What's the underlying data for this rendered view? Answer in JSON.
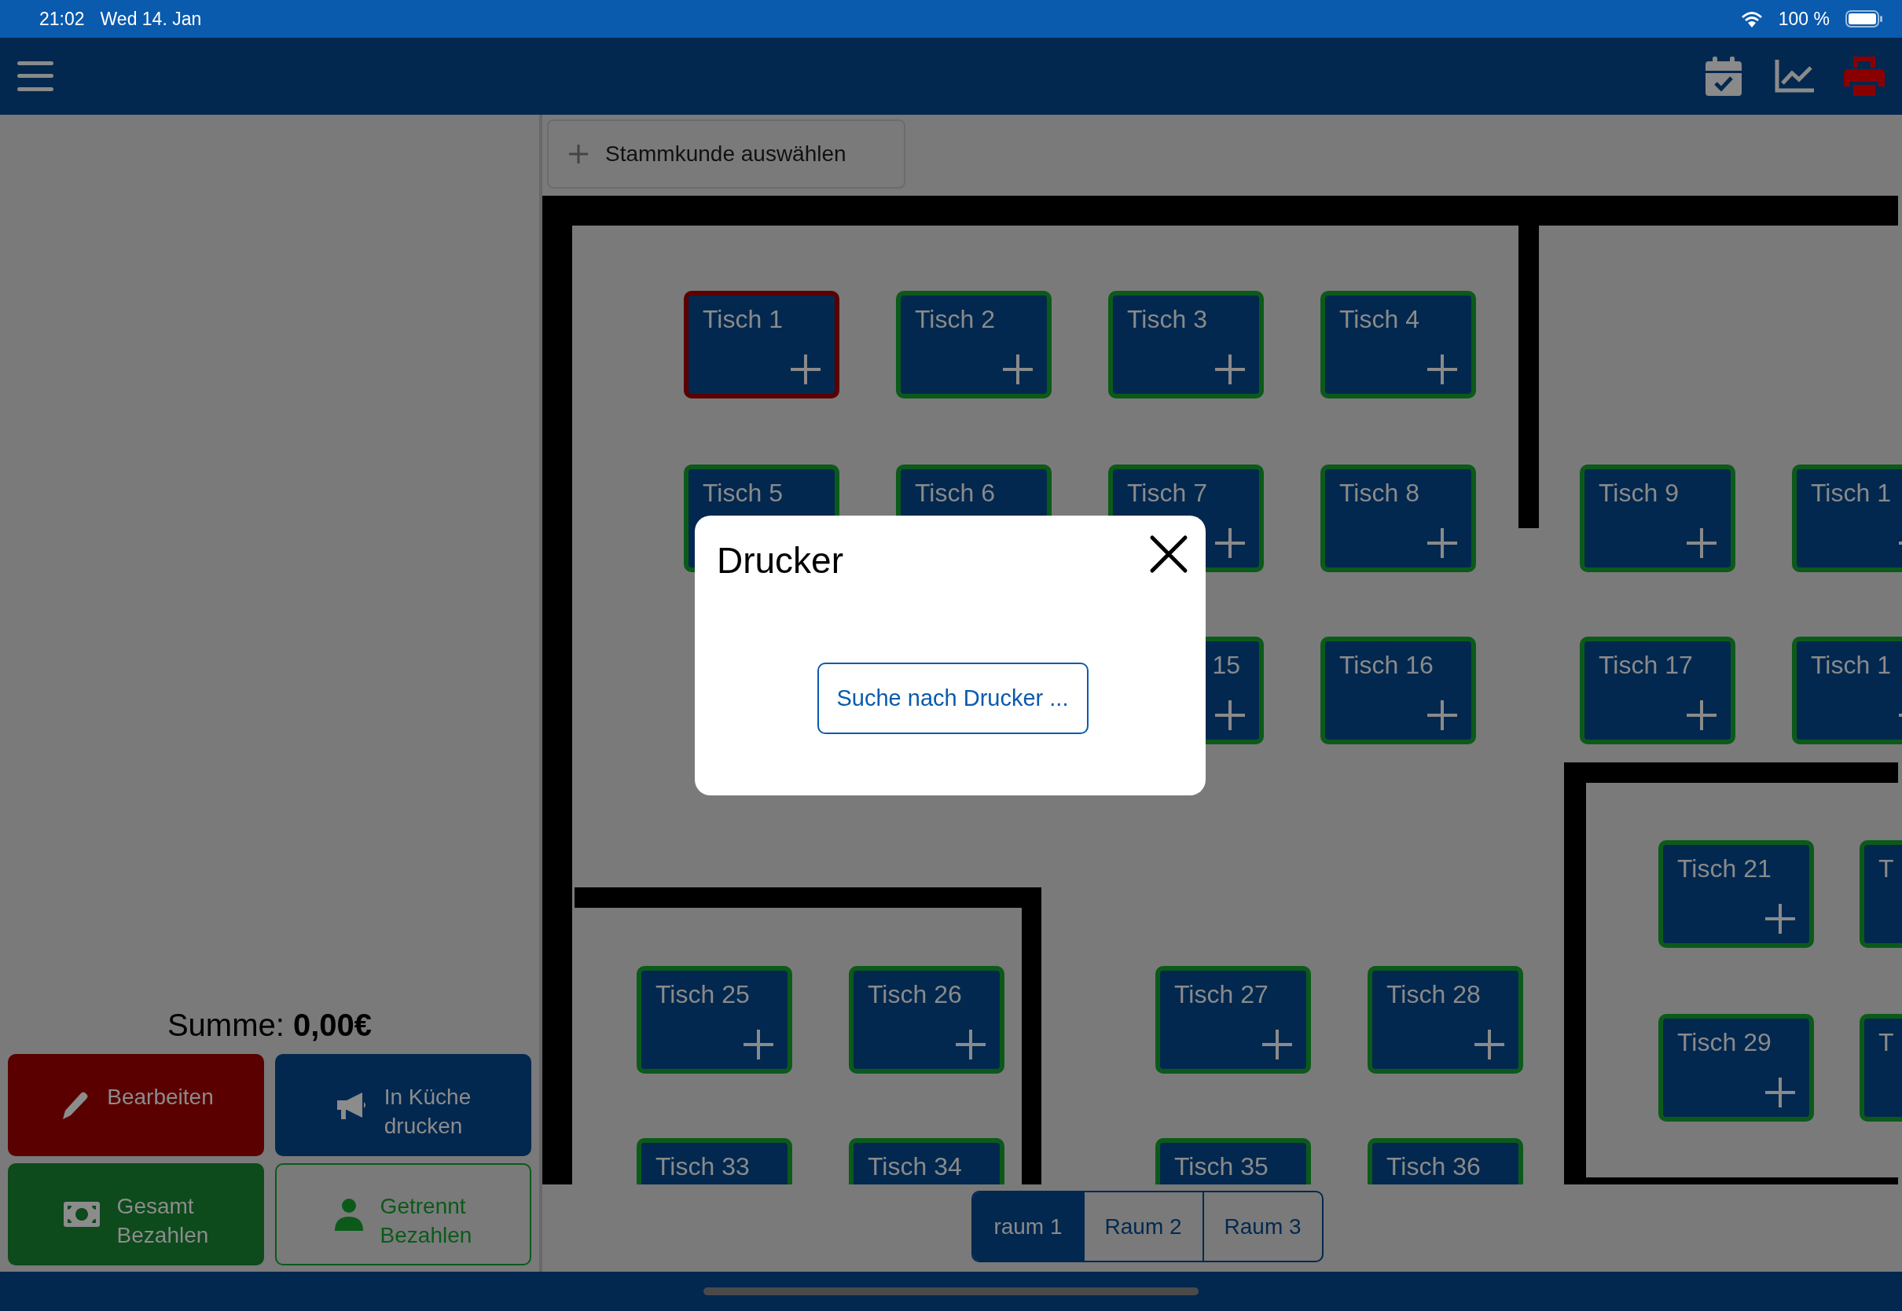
{
  "status_bar": {
    "time": "21:02",
    "date": "Wed 14. Jan",
    "battery": "100 %"
  },
  "customer_button": {
    "label": "Stammkunde auswählen"
  },
  "summary": {
    "label": "Summe:",
    "amount": "0,00€"
  },
  "actions": [
    {
      "kind": "danger",
      "lines": [
        "Bearbeiten"
      ]
    },
    {
      "kind": "primary",
      "lines": [
        "In Küche",
        "drucken"
      ]
    },
    {
      "kind": "success",
      "lines": [
        "Gesamt",
        "Bezahlen"
      ]
    },
    {
      "kind": "outline",
      "lines": [
        "Getrennt",
        "Bezahlen"
      ]
    }
  ],
  "floor": {
    "tables": [
      {
        "label": "Tisch 1",
        "color": "#5a0000",
        "partly_hidden": false,
        "add_icon": true
      },
      {
        "label": "Tisch 2",
        "color": "#0b5a1a",
        "partly_hidden": false,
        "add_icon": true
      },
      {
        "label": "Tisch 3",
        "color": "#0b5a1a",
        "partly_hidden": false,
        "add_icon": true
      },
      {
        "label": "Tisch 4",
        "color": "#0b5a1a",
        "partly_hidden": false,
        "add_icon": true
      },
      {
        "label": "Tisch 5",
        "color": "#0b5a1a",
        "partly_hidden": false,
        "add_icon": false
      },
      {
        "label": "Tisch 6",
        "color": "#0b5a1a",
        "partly_hidden": false,
        "add_icon": false
      },
      {
        "label": "Tisch 7",
        "color": "#0b5a1a",
        "partly_hidden": false,
        "add_icon": true
      },
      {
        "label": "Tisch 8",
        "color": "#0b5a1a",
        "partly_hidden": false,
        "add_icon": true
      },
      {
        "label": "Tisch 9",
        "color": "#0b5a1a",
        "partly_hidden": false,
        "add_icon": true
      },
      {
        "label": "Tisch 1",
        "color": "#0b5a1a",
        "partly_hidden": false,
        "add_icon": true
      },
      {
        "label": "15",
        "color": "#0b5a1a",
        "partly_hidden": true,
        "add_icon": true
      },
      {
        "label": "Tisch 16",
        "color": "#0b5a1a",
        "partly_hidden": false,
        "add_icon": true
      },
      {
        "label": "Tisch 17",
        "color": "#0b5a1a",
        "partly_hidden": false,
        "add_icon": true
      },
      {
        "label": "Tisch 1",
        "color": "#0b5a1a",
        "partly_hidden": false,
        "add_icon": true
      },
      {
        "label": "Tisch 21",
        "color": "#0b5a1a",
        "partly_hidden": false,
        "add_icon": true
      },
      {
        "label": "T",
        "color": "#0b5a1a",
        "partly_hidden": false,
        "add_icon": false
      },
      {
        "label": "Tisch 25",
        "color": "#0b5a1a",
        "partly_hidden": false,
        "add_icon": true
      },
      {
        "label": "Tisch 26",
        "color": "#0b5a1a",
        "partly_hidden": false,
        "add_icon": true
      },
      {
        "label": "Tisch 27",
        "color": "#0b5a1a",
        "partly_hidden": false,
        "add_icon": true
      },
      {
        "label": "Tisch 28",
        "color": "#0b5a1a",
        "partly_hidden": false,
        "add_icon": true
      },
      {
        "label": "Tisch 29",
        "color": "#0b5a1a",
        "partly_hidden": false,
        "add_icon": true
      },
      {
        "label": "T",
        "color": "#0b5a1a",
        "partly_hidden": false,
        "add_icon": false
      },
      {
        "label": "Tisch 33",
        "color": "#0b5a1a",
        "partly_hidden": false,
        "add_icon": false
      },
      {
        "label": "Tisch 34",
        "color": "#0b5a1a",
        "partly_hidden": false,
        "add_icon": false
      },
      {
        "label": "Tisch 35",
        "color": "#0b5a1a",
        "partly_hidden": false,
        "add_icon": false
      },
      {
        "label": "Tisch 36",
        "color": "#0b5a1a",
        "partly_hidden": false,
        "add_icon": false
      }
    ]
  },
  "rooms": [
    {
      "label": "raum 1",
      "selected": true
    },
    {
      "label": "Raum 2",
      "selected": false
    },
    {
      "label": "Raum 3",
      "selected": false
    }
  ],
  "dialog": {
    "title": "Drucker",
    "button": "Suche nach Drucker ..."
  }
}
